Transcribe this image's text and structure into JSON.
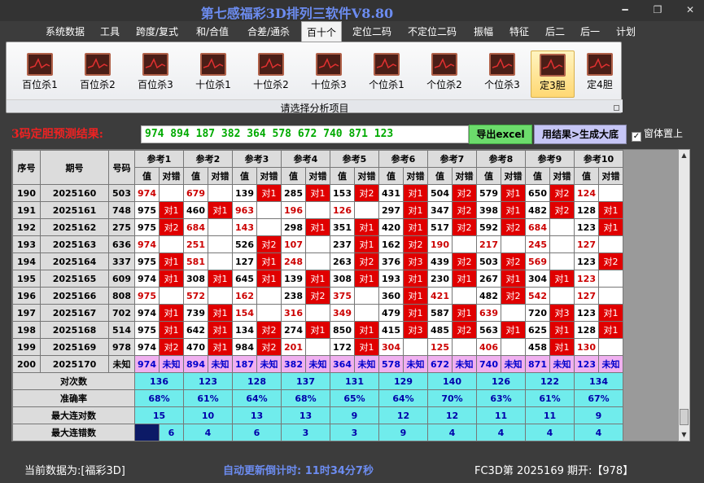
{
  "window": {
    "title": "第七感福彩3D排列三软件V8.80",
    "minimize": "━",
    "restore": "❐",
    "close": "✕"
  },
  "menu": [
    "系统数据",
    "工具",
    "跨度/复式",
    "和/合值",
    "合差/通杀",
    "百十个",
    "定位二码",
    "不定位二码",
    "振幅",
    "特征",
    "后二",
    "后一",
    "计划"
  ],
  "menu_active": "百十个",
  "ribbon": {
    "buttons": [
      "百位杀1",
      "百位杀2",
      "百位杀3",
      "十位杀1",
      "十位杀2",
      "十位杀3",
      "个位杀1",
      "个位杀2",
      "个位杀3",
      "定3胆",
      "定4胆"
    ],
    "active": "定3胆",
    "caption": "请选择分析项目"
  },
  "result": {
    "label": "3码定胆预测结果:",
    "value": "974 894 187 382 364 578 672 740 871 123",
    "export_label": "导出excel",
    "generate_label": "用结果>生成大底",
    "ontop_label": "窗体置上",
    "ontop_checked": "✓"
  },
  "table": {
    "headers": {
      "seq": "序号",
      "period": "期号",
      "number": "号码"
    },
    "groups": [
      "参考1",
      "参考2",
      "参考3",
      "参考4",
      "参考5",
      "参考6",
      "参考7",
      "参考8",
      "参考9",
      "参考10"
    ],
    "sub": {
      "value": "值",
      "check": "对错"
    },
    "rows": [
      {
        "seq": "190",
        "period": "2025160",
        "num": "503",
        "cells": [
          [
            "974",
            "",
            0
          ],
          [
            "679",
            "",
            0
          ],
          [
            "139",
            "对1",
            1
          ],
          [
            "285",
            "对1",
            1
          ],
          [
            "153",
            "对2",
            1
          ],
          [
            "431",
            "对1",
            1
          ],
          [
            "504",
            "对2",
            1
          ],
          [
            "579",
            "对1",
            1
          ],
          [
            "650",
            "对2",
            1
          ],
          [
            "124",
            "",
            0
          ]
        ]
      },
      {
        "seq": "191",
        "period": "2025161",
        "num": "748",
        "cells": [
          [
            "975",
            "对1",
            1
          ],
          [
            "460",
            "对1",
            1
          ],
          [
            "963",
            "",
            0
          ],
          [
            "196",
            "",
            0
          ],
          [
            "126",
            "",
            0
          ],
          [
            "297",
            "对1",
            1
          ],
          [
            "347",
            "对2",
            1
          ],
          [
            "398",
            "对1",
            1
          ],
          [
            "482",
            "对2",
            1
          ],
          [
            "128",
            "对1",
            1
          ]
        ]
      },
      {
        "seq": "192",
        "period": "2025162",
        "num": "275",
        "cells": [
          [
            "975",
            "对2",
            1
          ],
          [
            "684",
            "",
            0
          ],
          [
            "143",
            "",
            0
          ],
          [
            "298",
            "对1",
            1
          ],
          [
            "351",
            "对1",
            1
          ],
          [
            "420",
            "对1",
            1
          ],
          [
            "517",
            "对2",
            1
          ],
          [
            "592",
            "对2",
            1
          ],
          [
            "684",
            "",
            0
          ],
          [
            "123",
            "对1",
            1
          ]
        ]
      },
      {
        "seq": "193",
        "period": "2025163",
        "num": "636",
        "cells": [
          [
            "974",
            "",
            0
          ],
          [
            "251",
            "",
            0
          ],
          [
            "526",
            "对2",
            1
          ],
          [
            "107",
            "",
            0
          ],
          [
            "237",
            "对1",
            1
          ],
          [
            "162",
            "对2",
            1
          ],
          [
            "190",
            "",
            0
          ],
          [
            "217",
            "",
            0
          ],
          [
            "245",
            "",
            0
          ],
          [
            "127",
            "",
            0
          ]
        ]
      },
      {
        "seq": "194",
        "period": "2025164",
        "num": "337",
        "cells": [
          [
            "975",
            "对1",
            1
          ],
          [
            "581",
            "",
            0
          ],
          [
            "127",
            "对1",
            1
          ],
          [
            "248",
            "",
            0
          ],
          [
            "263",
            "对2",
            1
          ],
          [
            "376",
            "对3",
            1
          ],
          [
            "439",
            "对2",
            1
          ],
          [
            "503",
            "对2",
            1
          ],
          [
            "569",
            "",
            0
          ],
          [
            "123",
            "对2",
            1
          ]
        ]
      },
      {
        "seq": "195",
        "period": "2025165",
        "num": "609",
        "cells": [
          [
            "974",
            "对1",
            1
          ],
          [
            "308",
            "对1",
            1
          ],
          [
            "645",
            "对1",
            1
          ],
          [
            "139",
            "对1",
            1
          ],
          [
            "308",
            "对1",
            1
          ],
          [
            "193",
            "对1",
            1
          ],
          [
            "230",
            "对1",
            1
          ],
          [
            "267",
            "对1",
            1
          ],
          [
            "304",
            "对1",
            1
          ],
          [
            "123",
            "",
            0
          ]
        ]
      },
      {
        "seq": "196",
        "period": "2025166",
        "num": "808",
        "cells": [
          [
            "975",
            "",
            0
          ],
          [
            "572",
            "",
            0
          ],
          [
            "162",
            "",
            0
          ],
          [
            "238",
            "对2",
            1
          ],
          [
            "375",
            "",
            0
          ],
          [
            "360",
            "对1",
            1
          ],
          [
            "421",
            "",
            0
          ],
          [
            "482",
            "对2",
            1
          ],
          [
            "542",
            "",
            0
          ],
          [
            "127",
            "",
            0
          ]
        ]
      },
      {
        "seq": "197",
        "period": "2025167",
        "num": "702",
        "cells": [
          [
            "974",
            "对1",
            1
          ],
          [
            "739",
            "对1",
            1
          ],
          [
            "154",
            "",
            0
          ],
          [
            "316",
            "",
            0
          ],
          [
            "349",
            "",
            0
          ],
          [
            "479",
            "对1",
            1
          ],
          [
            "587",
            "对1",
            1
          ],
          [
            "639",
            "",
            0
          ],
          [
            "720",
            "对3",
            1
          ],
          [
            "123",
            "对1",
            1
          ]
        ]
      },
      {
        "seq": "198",
        "period": "2025168",
        "num": "514",
        "cells": [
          [
            "975",
            "对1",
            1
          ],
          [
            "642",
            "对1",
            1
          ],
          [
            "134",
            "对2",
            1
          ],
          [
            "274",
            "对1",
            1
          ],
          [
            "850",
            "对1",
            1
          ],
          [
            "415",
            "对3",
            1
          ],
          [
            "485",
            "对2",
            1
          ],
          [
            "563",
            "对1",
            1
          ],
          [
            "625",
            "对1",
            1
          ],
          [
            "128",
            "对1",
            1
          ]
        ]
      },
      {
        "seq": "199",
        "period": "2025169",
        "num": "978",
        "cells": [
          [
            "974",
            "对2",
            1
          ],
          [
            "470",
            "对1",
            1
          ],
          [
            "984",
            "对2",
            1
          ],
          [
            "201",
            "",
            0
          ],
          [
            "172",
            "对1",
            1
          ],
          [
            "304",
            "",
            0
          ],
          [
            "125",
            "",
            0
          ],
          [
            "406",
            "",
            0
          ],
          [
            "458",
            "对1",
            1
          ],
          [
            "130",
            "",
            0
          ]
        ]
      }
    ],
    "pred_row": {
      "seq": "200",
      "period": "2025170",
      "num": "未知",
      "values": [
        "974",
        "894",
        "187",
        "382",
        "364",
        "578",
        "672",
        "740",
        "871",
        "123"
      ],
      "check": "未知"
    },
    "stats": [
      {
        "label": "对次数",
        "values": [
          "136",
          "123",
          "128",
          "137",
          "131",
          "129",
          "140",
          "126",
          "122",
          "134"
        ]
      },
      {
        "label": "准确率",
        "values": [
          "68%",
          "61%",
          "64%",
          "68%",
          "65%",
          "64%",
          "70%",
          "63%",
          "61%",
          "67%"
        ]
      },
      {
        "label": "最大连对数",
        "values": [
          "15",
          "10",
          "13",
          "13",
          "9",
          "12",
          "12",
          "11",
          "11",
          "9"
        ]
      },
      {
        "label": "最大连错数",
        "values": [
          "6",
          "4",
          "6",
          "3",
          "3",
          "9",
          "4",
          "4",
          "4",
          "4"
        ]
      }
    ]
  },
  "status": {
    "current_data": "当前数据为:[福彩3D]",
    "countdown": "自动更新倒计时: 11时34分7秒",
    "draw_info": "FC3D第 2025169 期开:【978】"
  }
}
